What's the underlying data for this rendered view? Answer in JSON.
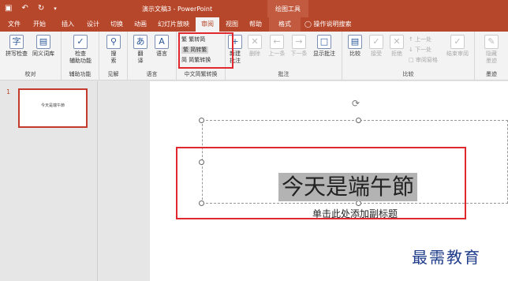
{
  "titlebar": {
    "save_icon": "save-icon",
    "undo_icon": "undo-icon",
    "redo_icon": "redo-icon",
    "doc_title": "演示文稿3 - PowerPoint",
    "context_tools": "绘图工具"
  },
  "tabs": [
    "文件",
    "开始",
    "插入",
    "设计",
    "切换",
    "动画",
    "幻灯片放映",
    "审阅",
    "视图",
    "帮助",
    "格式",
    "操作说明搜索"
  ],
  "ribbon": {
    "groups": {
      "proofing": {
        "label": "校对",
        "spell": "拼写检查",
        "thesaurus": "同义词库"
      },
      "accessibility": {
        "label": "辅助功能",
        "check": "检查\n辅助功能"
      },
      "insights": {
        "label": "见解",
        "lookup": "搜\n索"
      },
      "language": {
        "label": "语言",
        "translate": "翻\n译",
        "lang": "语言"
      },
      "chinese": {
        "label": "中文简繁转换",
        "to_simplified": "繁转简",
        "to_traditional": "简转繁",
        "convert": "简繁转换"
      },
      "comments": {
        "label": "批注",
        "new": "新建\n批注",
        "delete": "删除",
        "prev": "上一条",
        "next": "下一条",
        "show": "显示批注"
      },
      "compare": {
        "label": "比较",
        "compare": "比较",
        "accept": "接受",
        "reject": "拒绝",
        "prev": "上一处",
        "next": "下一处",
        "pane": "审阅窗格",
        "end": "结束审阅"
      },
      "ink": {
        "label": "墨迹",
        "hide": "隐藏\n墨迹"
      }
    }
  },
  "slides": {
    "number": "1",
    "thumb_text": "今天是端午節"
  },
  "slide": {
    "title": "今天是端午節",
    "subtitle": "单击此处添加副标题"
  },
  "watermark": "最需教育",
  "colors": {
    "brand": "#b7472a",
    "highlight": "#e0282e",
    "watermark": "#1f3c8a"
  }
}
